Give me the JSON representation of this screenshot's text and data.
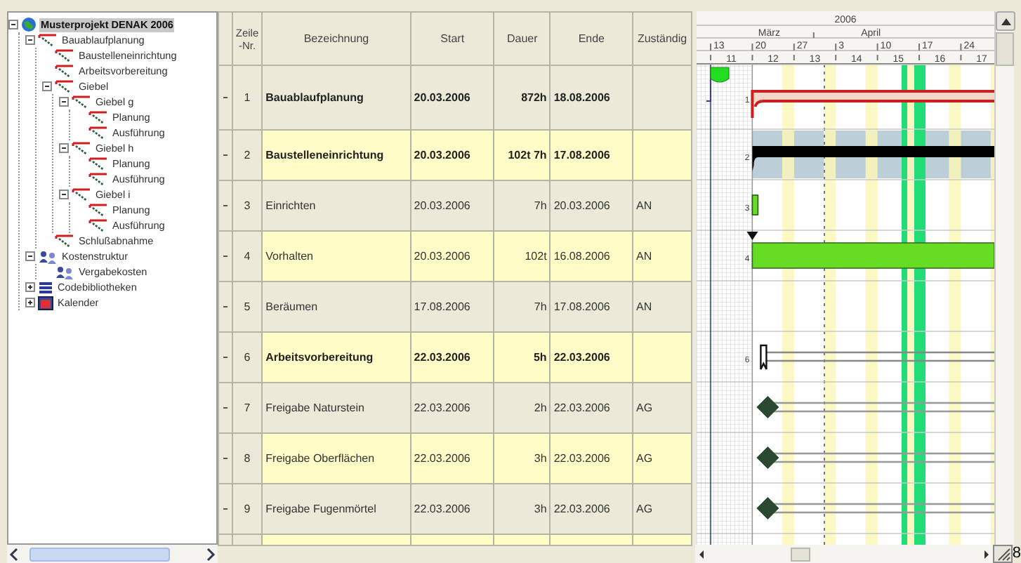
{
  "tree": [
    {
      "label": "Musterprojekt DENAK 2006",
      "kind": "globe",
      "selected": true,
      "expanded": true,
      "children": [
        {
          "label": "Bauablaufplanung",
          "kind": "task",
          "selected": false,
          "expanded": true,
          "children": [
            {
              "label": "Baustelleneinrichtung",
              "kind": "task",
              "selected": false
            },
            {
              "label": "Arbeitsvorbereitung",
              "kind": "task",
              "selected": false
            },
            {
              "label": "Giebel",
              "kind": "task",
              "selected": false,
              "expanded": true,
              "children": [
                {
                  "label": "Giebel g",
                  "kind": "task",
                  "selected": false,
                  "expanded": true,
                  "children": [
                    {
                      "label": "Planung",
                      "kind": "task",
                      "selected": false
                    },
                    {
                      "label": "Ausführung",
                      "kind": "task",
                      "selected": false
                    }
                  ]
                },
                {
                  "label": "Giebel h",
                  "kind": "task",
                  "selected": false,
                  "expanded": true,
                  "children": [
                    {
                      "label": "Planung",
                      "kind": "task",
                      "selected": false
                    },
                    {
                      "label": "Ausführung",
                      "kind": "task",
                      "selected": false
                    }
                  ]
                },
                {
                  "label": "Giebel i",
                  "kind": "task",
                  "selected": false,
                  "expanded": true,
                  "children": [
                    {
                      "label": "Planung",
                      "kind": "task",
                      "selected": false
                    },
                    {
                      "label": "Ausführung",
                      "kind": "task",
                      "selected": false
                    }
                  ]
                }
              ]
            },
            {
              "label": "Schlußabnahme",
              "kind": "task",
              "selected": false
            }
          ]
        },
        {
          "label": "Kostenstruktur",
          "kind": "cost",
          "selected": false,
          "expanded": true,
          "children": [
            {
              "label": "Vergabekosten",
              "kind": "cost",
              "selected": false
            }
          ]
        },
        {
          "label": "Codebibliotheken",
          "kind": "library",
          "selected": false,
          "expanded": false
        },
        {
          "label": "Kalender",
          "kind": "calendar",
          "selected": false,
          "expanded": false
        }
      ]
    }
  ],
  "table": {
    "columns": [
      "Zeile -Nr.",
      "Bezeichnung",
      "Start",
      "Dauer",
      "Ende",
      "Zuständig"
    ],
    "rows": [
      {
        "nr": "1",
        "name": "Bauablaufplanung",
        "start": "20.03.2006",
        "duration": "872h",
        "end": "18.08.2006",
        "kind": "summary",
        "shaded": false,
        "bar": {
          "kind": "summary",
          "color": "#cc2020",
          "label": "1"
        }
      },
      {
        "nr": "2",
        "name": "Baustelleneinrichtung",
        "start": "20.03.2006",
        "duration": "102t 7h",
        "end": "17.08.2006",
        "kind": "summary",
        "shaded": true,
        "bar": {
          "kind": "summary",
          "color": "#000000",
          "label": "2"
        }
      },
      {
        "nr": "3",
        "name": "Einrichten",
        "start": "20.03.2006",
        "duration": "7h",
        "end": "20.03.2006",
        "responsible": "AN",
        "kind": "task",
        "shaded": false,
        "bar": {
          "kind": "task",
          "color": "#66dd22",
          "label": "3"
        }
      },
      {
        "nr": "4",
        "name": "Vorhalten",
        "start": "20.03.2006",
        "duration": "102t",
        "end": "16.08.2006",
        "responsible": "AN",
        "kind": "task",
        "shaded": false,
        "bar": {
          "kind": "long-task",
          "color": "#66dd22",
          "label": "4"
        }
      },
      {
        "nr": "5",
        "name": "Beräumen",
        "start": "17.08.2006",
        "duration": "7h",
        "end": "17.08.2006",
        "responsible": "AN",
        "kind": "task",
        "shaded": false
      },
      {
        "nr": "6",
        "name": "Arbeitsvorbereitung",
        "start": "22.03.2006",
        "duration": "5h",
        "end": "22.03.2006",
        "kind": "summary",
        "shaded": false,
        "bar": {
          "kind": "bracket",
          "label": "6"
        }
      },
      {
        "nr": "7",
        "name": "Freigabe Naturstein",
        "start": "22.03.2006",
        "duration": "2h",
        "end": "22.03.2006",
        "responsible": "AG",
        "kind": "task",
        "shaded": false,
        "bar": {
          "kind": "milestone"
        }
      },
      {
        "nr": "8",
        "name": "Freigabe Oberflächen",
        "start": "22.03.2006",
        "duration": "3h",
        "end": "22.03.2006",
        "responsible": "AG",
        "kind": "task",
        "shaded": false,
        "bar": {
          "kind": "milestone"
        }
      },
      {
        "nr": "9",
        "name": "Freigabe Fugenmörtel",
        "start": "22.03.2006",
        "duration": "3h",
        "end": "22.03.2006",
        "responsible": "AG",
        "kind": "task",
        "shaded": false,
        "bar": {
          "kind": "milestone"
        }
      }
    ]
  },
  "timeline": {
    "year": "2006",
    "months": [
      "März",
      "April"
    ],
    "week_dates": [
      "13",
      "20",
      "27",
      "3",
      "10",
      "17",
      "24"
    ],
    "week_numbers": [
      "11",
      "12",
      "13",
      "14",
      "15",
      "16",
      "17"
    ]
  },
  "edge_text": "8"
}
